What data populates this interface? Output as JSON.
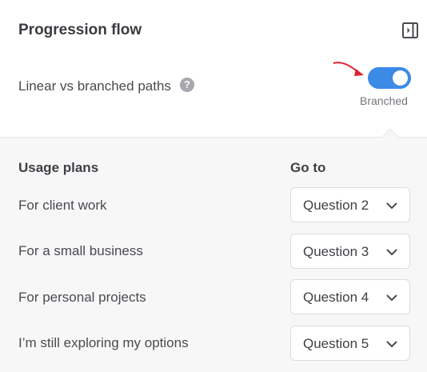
{
  "panel": {
    "title": "Progression flow"
  },
  "setting": {
    "label": "Linear vs branched paths",
    "help_glyph": "?",
    "toggle_on": true,
    "toggle_state_label": "Branched"
  },
  "columns": {
    "usage": "Usage plans",
    "goto": "Go to"
  },
  "rows": [
    {
      "label": "For client work",
      "goto": "Question 2"
    },
    {
      "label": "For a small business",
      "goto": "Question 3"
    },
    {
      "label": "For personal projects",
      "goto": "Question 4"
    },
    {
      "label": "I’m still exploring my options",
      "goto": "Question 5"
    }
  ],
  "colors": {
    "accent": "#3b8ae6",
    "annotation_arrow": "#e0202c"
  },
  "icons": {
    "collapse": "panel-collapse-icon",
    "help": "help-icon",
    "dropdown": "chevron-down-icon"
  }
}
